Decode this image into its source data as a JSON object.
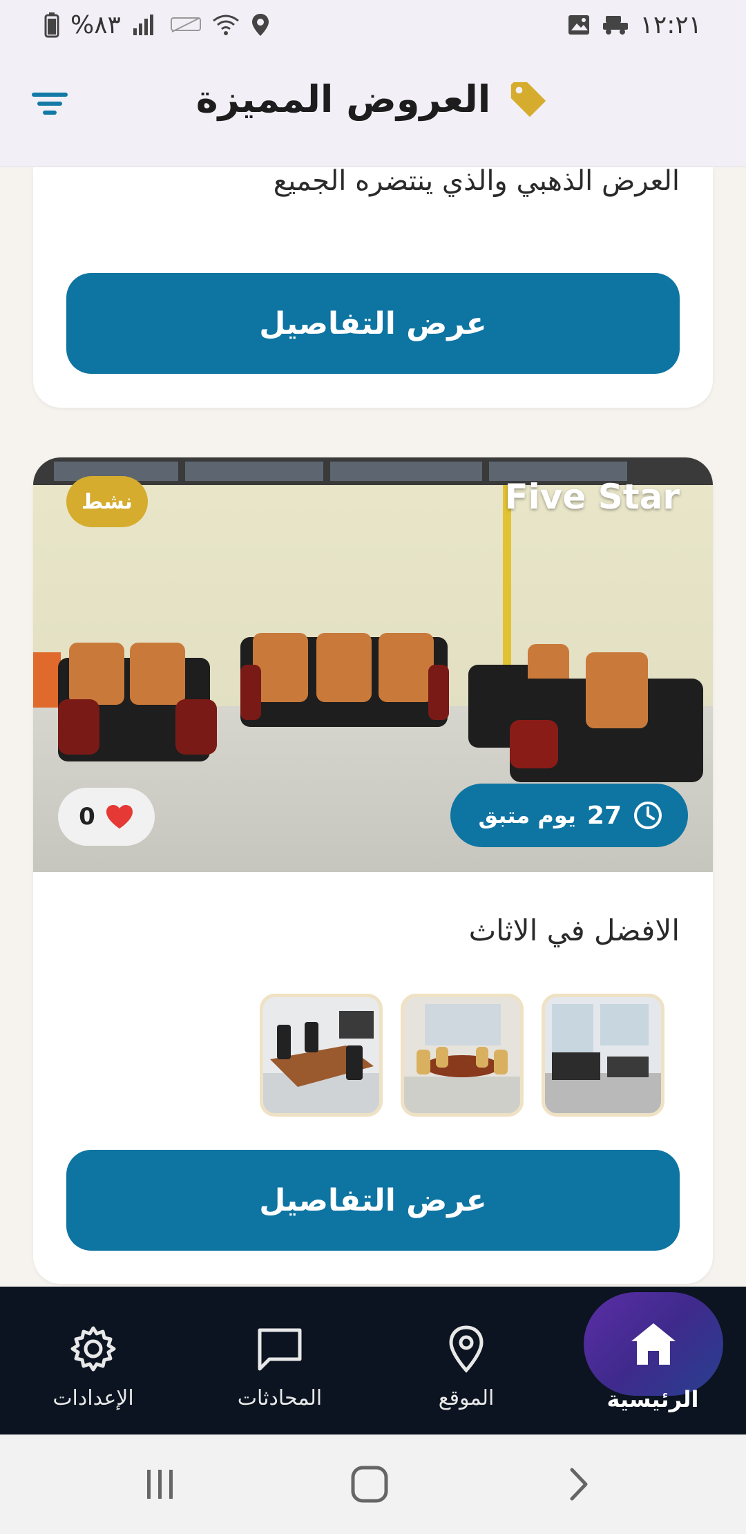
{
  "status_bar": {
    "time": "١٢:٢١",
    "battery": "%٨٣"
  },
  "header": {
    "title": "العروض المميزة",
    "filter_icon": "filter-icon",
    "tag_icon": "tag-icon",
    "tag_color": "#d5ac2e"
  },
  "offers": [
    {
      "description": "العرض الذهبي والذي ينتضره الجميع",
      "button_label": "عرض التفاصيل"
    },
    {
      "status": "نشط",
      "title": "Five Star",
      "days_number": "27",
      "days_text": "يوم متبق",
      "likes": "0",
      "description": "الافضل في الاثاث",
      "button_label": "عرض التفاصيل"
    }
  ],
  "bottom_nav": {
    "items": [
      {
        "label": "الرئيسية",
        "icon": "home-icon",
        "active": true
      },
      {
        "label": "الموقع",
        "icon": "location-icon",
        "active": false
      },
      {
        "label": "المحادثات",
        "icon": "chat-icon",
        "active": false
      },
      {
        "label": "الإعدادات",
        "icon": "gear-icon",
        "active": false
      }
    ]
  },
  "colors": {
    "primary": "#0e74a2",
    "badge": "#d5ac2e",
    "nav_background": "#0b1420",
    "heart": "#e53935"
  }
}
